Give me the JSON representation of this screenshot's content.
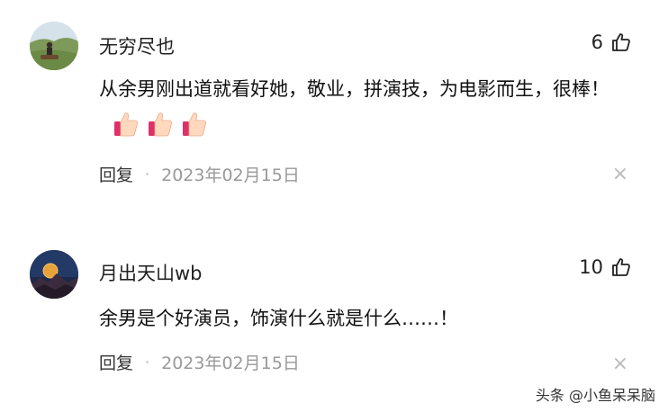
{
  "comments": [
    {
      "username": "无穷尽也",
      "likes": "6",
      "text": "从余男刚出道就看好她，敬业，拼演技，为电影而生，很棒！",
      "emoji_count": 3,
      "reply_label": "回复",
      "separator": "·",
      "date": "2023年02月15日",
      "close": "×"
    },
    {
      "username": "月出天山wb",
      "likes": "10",
      "text": "余男是个好演员，饰演什么就是什么……！",
      "reply_label": "回复",
      "separator": "·",
      "date": "2023年02月15日",
      "close": "×"
    }
  ],
  "watermark": "头条 @小鱼呆呆脑",
  "icons": {
    "like": "thumbs-up-outline-icon",
    "emoji": "thumbs-up-emoji-icon",
    "close": "close-icon"
  }
}
